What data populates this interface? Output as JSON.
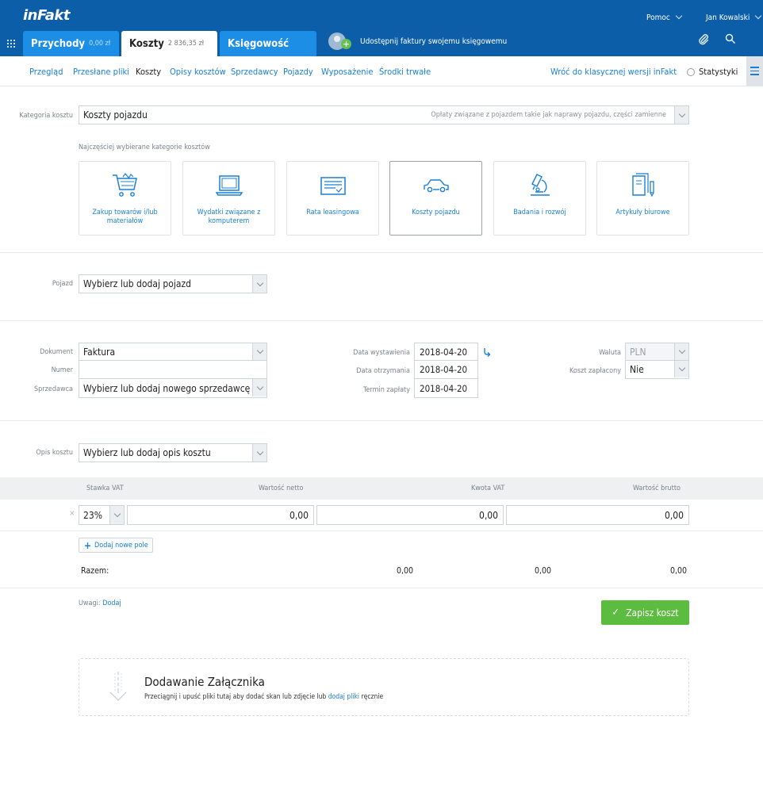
{
  "header": {
    "logo": "inFakt",
    "help": "Pomoc",
    "user": "Jan Kowalski",
    "tabs": [
      {
        "label": "Przychody",
        "amount": "0,00 zł"
      },
      {
        "label": "Koszty",
        "amount": "2 836,35 zł"
      },
      {
        "label": "Księgowość",
        "amount": ""
      }
    ],
    "share_text": "Udostępnij faktury swojemu księgowemu"
  },
  "subnav": {
    "items": [
      "Przegląd",
      "Przesłane pliki",
      "Koszty",
      "Opisy kosztów",
      "Sprzedawcy",
      "Pojazdy",
      "Wyposażenie",
      "Środki trwałe"
    ],
    "active": "Koszty",
    "classic_link": "Wróć do klasycznej wersji inFakt",
    "stats": "Statystyki"
  },
  "category": {
    "label": "Kategoria kosztu",
    "value": "Koszty pojazdu",
    "hint": "Opłaty związane z pojazdem takie jak naprawy pojazdu, części zamienne",
    "frequent_label": "Najczęściej wybierane kategorie kosztów",
    "cards": [
      {
        "label": "Zakup towarów i/lub materiałów",
        "icon": "shopping-cart-icon"
      },
      {
        "label": "Wydatki związane z komputerem",
        "icon": "laptop-icon"
      },
      {
        "label": "Rata leasingowa",
        "icon": "leasing-document-icon"
      },
      {
        "label": "Koszty pojazdu",
        "icon": "car-icon"
      },
      {
        "label": "Badania i rozwój",
        "icon": "microscope-icon"
      },
      {
        "label": "Artykuły biurowe",
        "icon": "office-supplies-icon"
      }
    ],
    "selected": "Koszty pojazdu"
  },
  "vehicle": {
    "label": "Pojazd",
    "value": "Wybierz lub dodaj pojazd"
  },
  "document": {
    "doc_label": "Dokument",
    "doc_value": "Faktura",
    "number_label": "Numer",
    "number_value": "",
    "seller_label": "Sprzedawca",
    "seller_value": "Wybierz lub dodaj nowego sprzedawcę",
    "issue_label": "Data wystawienia",
    "issue_date": "2018-04-20",
    "receive_label": "Data otrzymania",
    "receive_date": "2018-04-20",
    "due_label": "Termin zapłaty",
    "due_date": "2018-04-20",
    "currency_label": "Waluta",
    "currency_value": "PLN",
    "paid_label": "Koszt zapłacony",
    "paid_value": "Nie"
  },
  "description": {
    "label": "Opis kosztu",
    "value": "Wybierz lub dodaj opis kosztu"
  },
  "vat_table": {
    "headers": [
      "Stawka VAT",
      "Wartość netto",
      "Kwota VAT",
      "Wartość brutto"
    ],
    "row": {
      "rate": "23%",
      "net": "0,00",
      "vat": "0,00",
      "gross": "0,00",
      "remove": "×"
    },
    "add_label": "Dodaj nowe pole",
    "total_label": "Razem:",
    "totals": {
      "net": "0,00",
      "vat": "0,00",
      "gross": "0,00"
    }
  },
  "notes": {
    "label": "Uwagi:",
    "link": "Dodaj"
  },
  "save_label": "Zapisz koszt",
  "attachment": {
    "title": "Dodawanie Załącznika",
    "text_before": "Przeciągnij i upuść pliki tutaj aby dodać skan lub zdjęcie lub",
    "link": "dodaj pliki",
    "text_after": "ręcznie"
  },
  "colors": {
    "topbar": "#0d5ea8",
    "tab_active": "#1c8ee6",
    "link": "#1a7fd4",
    "save": "#5cbc40"
  }
}
